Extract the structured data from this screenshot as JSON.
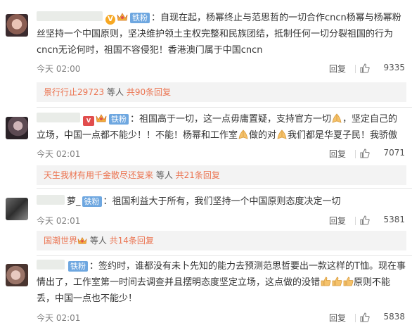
{
  "comments": [
    {
      "fan_badge": "铁粉",
      "text": "：自现在起，杨幂终止与范思哲的一切合作cncn杨幂与杨幂粉丝坚持一个中国原则，坚决维护领土主权完整和民族团结，抵制任何一切分裂祖国的行为cncn无论何时，祖国不容侵犯！香港澳门属于中国cncn",
      "time": "今天 02:00",
      "reply_label": "回复",
      "likes": "9335",
      "replies_prefix": "景行行止29723",
      "replies_mid": " 等人 ",
      "replies_count": "共90条回复"
    },
    {
      "fan_badge": "铁粉",
      "text_a": "：祖国高于一切，这一点毋庸置疑，支持官方一切",
      "text_b": "，坚定自己的立场，中国一点都不能少！！不能！杨幂和工作室",
      "text_c": "做的对",
      "text_d": "我们都是华夏子民！我骄傲",
      "time": "今天 02:01",
      "reply_label": "回复",
      "likes": "7071",
      "replies_prefix": "天生我材有用千金散尽还复来",
      "replies_mid": " 等人 ",
      "replies_count": "共21条回复"
    },
    {
      "name_tail": "萝_",
      "fan_badge": "铁粉",
      "text": "：祖国利益大于所有，我们坚持一个中国原则态度决定一切",
      "time": "今天 02:01",
      "reply_label": "回复",
      "likes": "5381",
      "replies_prefix": "国潮世界",
      "replies_mid": " 等人 ",
      "replies_count": "共14条回复"
    },
    {
      "fan_badge": "铁粉",
      "text_a": "：签约时，谁都没有未卜先知的能力去预测范思哲要出一款这样的T恤。现在事情出了，工作室第一时间去调查并且摆明态度坚定立场，这点做的没错",
      "text_b": "原则不能丢，中国一点也不能少！",
      "time": "今天 02:01",
      "reply_label": "回复",
      "likes": "5838"
    }
  ],
  "colors": {
    "link": "#eb7350",
    "fan_badge": "#6ea7e0",
    "vip": "#f7a823"
  },
  "icons": [
    "like-icon",
    "crown-icon",
    "v-badge-icon",
    "svip-icon",
    "pray-emoji-icon",
    "thumbs-up-emoji-icon"
  ]
}
